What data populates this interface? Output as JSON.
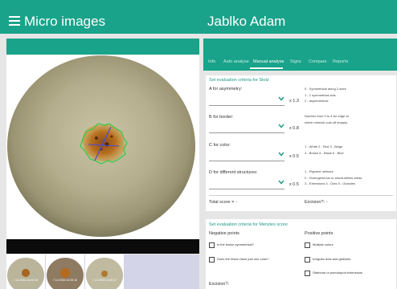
{
  "header": {
    "app_title": "Micro images",
    "patient_name": "Jablko Adam"
  },
  "colors": {
    "brand": "#19a38a",
    "accent_text": "#1a9a84",
    "lesion_outline": "#2ecc40",
    "axis_line": "#4a4ae0"
  },
  "icons": {
    "menu": "hamburger-icon",
    "dropdown": "chevron-down-icon",
    "checkbox": "checkbox-icon"
  },
  "tabs": [
    {
      "label": "Info",
      "active": false
    },
    {
      "label": "Auto analyse",
      "active": false
    },
    {
      "label": "Manual analyse",
      "active": true
    },
    {
      "label": "Signs",
      "active": false
    },
    {
      "label": "Compare",
      "active": false
    },
    {
      "label": "Reports",
      "active": false
    }
  ],
  "thumbnails": [
    {
      "label": "7.12.2016 14:00:15"
    },
    {
      "label": "7.12.2016 14:00:16"
    },
    {
      "label": "7.12.2016 14:00:17"
    }
  ],
  "stolz": {
    "title": "Set evaluation criteria for Stolz",
    "criteria": [
      {
        "label": "A for asymmetry:",
        "value": "",
        "factor": "x 1.3",
        "hints": [
          "0 - Symmetrical along 2 axes",
          "1 - 1 symmetrical axis",
          "2 - asymmetrical"
        ]
      },
      {
        "label": "B for border:",
        "value": "",
        "factor": "x 0.8",
        "hints": [
          "Number from 0 to 8 for edge at",
          "which network cuts off sharply"
        ]
      },
      {
        "label": "C for color:",
        "value": "",
        "factor": "x 0.5",
        "hints": [
          "1 - White 2 - Red 3 - Beige",
          "4 - Brown 5 - Black 6 - Blue"
        ]
      },
      {
        "label": "D for different structures:",
        "value": "",
        "factor": "x 0.5",
        "hints": [
          "1 - Pigment network",
          "2 - Homogeneous or structureless areas",
          "3 - Extensions 4 - Dots 5 - Globules"
        ]
      }
    ],
    "total_score_label": "Total score = -",
    "excision_label": "Excision?: -"
  },
  "menzies": {
    "title": "Set evaluation criteria for Menzies score",
    "negative_header": "Negative points",
    "positive_header": "Positive points",
    "negative_items": [
      {
        "label": "Is the lesion symmetrical?",
        "checked": false
      },
      {
        "label": "Does the lesion have just one color?",
        "checked": false
      }
    ],
    "positive_items": [
      {
        "label": "Multiple colors",
        "checked": false
      },
      {
        "label": "Irregular dots and globules",
        "checked": false
      },
      {
        "label": "Starburst or pseudopod extensions",
        "checked": false
      }
    ],
    "excision_label": "Excision?:"
  }
}
